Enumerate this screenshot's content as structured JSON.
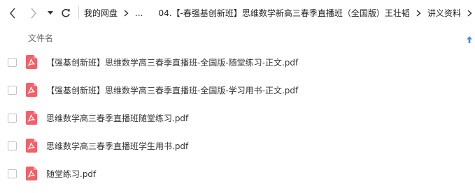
{
  "nav": {
    "back_icon": "chevron-left-icon",
    "forward_icon": "chevron-right-icon",
    "history_icon": "caret-down-icon",
    "refresh_icon": "refresh-icon"
  },
  "breadcrumb": [
    {
      "label": "我的网盘"
    },
    {
      "label": "..."
    },
    {
      "label": "04.【-春强基创新班】思维数学新高三春季直播班（全国版）王壮韬"
    },
    {
      "label": "讲义资料"
    }
  ],
  "list_header": {
    "name_label": "文件名",
    "sort_icon": "arrow-up-icon"
  },
  "files": [
    {
      "name": "【强基创新班】思维数学高三春季直播班-全国版-随堂练习-正文.pdf",
      "icon": "pdf-icon"
    },
    {
      "name": "【强基创新班】思维数学高三春季直播班-全国版-学习用书-正文.pdf",
      "icon": "pdf-icon"
    },
    {
      "name": "思维数学高三春季直播班随堂练习.pdf",
      "icon": "pdf-icon"
    },
    {
      "name": "思维数学高三春季直播班学生用书.pdf",
      "icon": "pdf-icon"
    },
    {
      "name": "随堂练习.pdf",
      "icon": "pdf-icon"
    }
  ],
  "colors": {
    "pdf_icon": "#f0616a",
    "sort_arrow": "#3b8be8"
  }
}
